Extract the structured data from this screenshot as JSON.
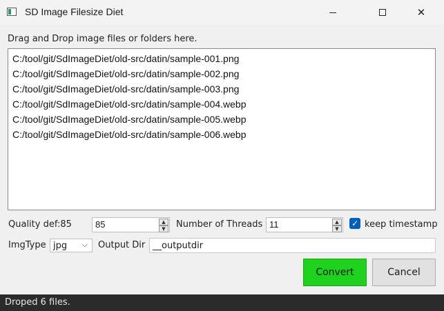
{
  "window": {
    "title": "SD Image Filesize Diet",
    "minimize_glyph": "",
    "close_glyph": "✕"
  },
  "drop_hint": "Drag and Drop image files or folders here.",
  "files": [
    "C:/tool/git/SdImageDiet/old-src/datin/sample-001.png",
    "C:/tool/git/SdImageDiet/old-src/datin/sample-002.png",
    "C:/tool/git/SdImageDiet/old-src/datin/sample-003.png",
    "C:/tool/git/SdImageDiet/old-src/datin/sample-004.webp",
    "C:/tool/git/SdImageDiet/old-src/datin/sample-005.webp",
    "C:/tool/git/SdImageDiet/old-src/datin/sample-006.webp"
  ],
  "quality": {
    "label": "Quality def:85",
    "value": "85"
  },
  "threads": {
    "label": "Number of Threads",
    "value": "11"
  },
  "keep_timestamp": {
    "label": "keep timestamp",
    "checked": true,
    "check_glyph": "✓"
  },
  "img_type": {
    "label": "ImgType",
    "value": "jpg",
    "chevron": "⌵"
  },
  "output_dir": {
    "label": "Output Dir",
    "value": "__outputdir"
  },
  "buttons": {
    "convert": "Convert",
    "cancel": "Cancel"
  },
  "status": "Droped 6 files.",
  "icons": {
    "app": "app-icon",
    "spin_up": "▲",
    "spin_down": "▼"
  },
  "colors": {
    "convert_bg": "#1ed21e",
    "checkbox_bg": "#005fb8",
    "statusbar_bg": "#2b2b2b"
  }
}
